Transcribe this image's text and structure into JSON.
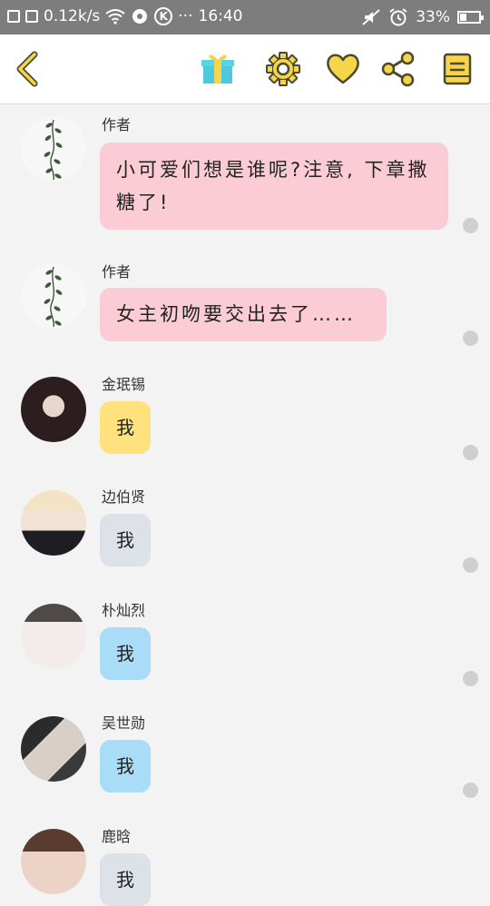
{
  "status_bar": {
    "speed": "0.12k/s",
    "dots": "···",
    "time": "16:40",
    "k_badge": "K",
    "battery_percent": "33%",
    "battery_level": 0.33
  },
  "toolbar": {
    "icons": [
      "back-icon",
      "gift-icon",
      "settings-icon",
      "heart-icon",
      "share-icon",
      "notes-icon"
    ],
    "accent_color": "#f6d54a",
    "outline_color": "#4a4a2e"
  },
  "messages": [
    {
      "name": "作者",
      "text": "小可爱们想是谁呢?注意, 下章撒糖了!",
      "bubble_color": "#fcccd6",
      "avatar": "plant"
    },
    {
      "name": "作者",
      "text": "女主初吻要交出去了……",
      "bubble_color": "#fcccd6",
      "avatar": "plant"
    },
    {
      "name": "金珉锡",
      "text": "我",
      "bubble_color": "#ffe27e",
      "avatar": "photo"
    },
    {
      "name": "边伯贤",
      "text": "我",
      "bubble_color": "#dde1e8",
      "avatar": "photo"
    },
    {
      "name": "朴灿烈",
      "text": "我",
      "bubble_color": "#a9dcf7",
      "avatar": "photo"
    },
    {
      "name": "吴世勋",
      "text": "我",
      "bubble_color": "#a9dcf7",
      "avatar": "photo"
    },
    {
      "name": "鹿晗",
      "text": "我",
      "bubble_color": "#dde1e8",
      "avatar": "photo"
    }
  ]
}
